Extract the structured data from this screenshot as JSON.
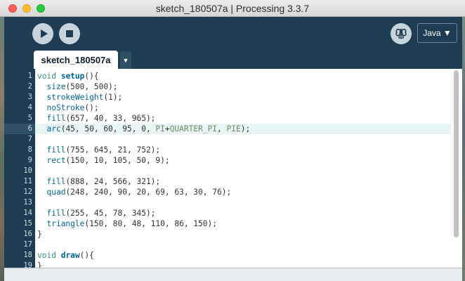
{
  "window": {
    "title": "sketch_180507a | Processing 3.3.7"
  },
  "toolbar": {
    "run_icon": "play-icon",
    "stop_icon": "stop-icon",
    "debug_icon": "butterfly-debug-icon",
    "mode_label": "Java ▼"
  },
  "tabs": {
    "active_label": "sketch_180507a",
    "menu_glyph": "▼"
  },
  "editor": {
    "current_line": 6,
    "line_numbers": [
      "1",
      "2",
      "3",
      "4",
      "5",
      "6",
      "7",
      "8",
      "9",
      "10",
      "11",
      "12",
      "13",
      "14",
      "15",
      "16",
      "17",
      "18",
      "19"
    ],
    "lines": [
      "void setup(){",
      "  size(500, 500);",
      "  strokeWeight(1);",
      "  noStroke();",
      "  fill(657, 40, 33, 965);",
      "  arc(45, 50, 60, 95, 0, PI+QUARTER_PI, PIE);",
      "",
      "  fill(755, 645, 21, 752);",
      "  rect(150, 10, 105, 50, 9);",
      "",
      "  fill(888, 24, 566, 321);",
      "  quad(248, 240, 90, 20, 69, 63, 30, 76);",
      "",
      "  fill(255, 45, 78, 345);",
      "  triangle(150, 80, 48, 110, 86, 150);",
      "}",
      "",
      "void draw(){",
      "}"
    ]
  },
  "colors": {
    "frame": "#1e3d52",
    "keyword": "#33997e",
    "function": "#006699",
    "constant": "#718a62",
    "current_line_bg": "#e8f5f5"
  }
}
